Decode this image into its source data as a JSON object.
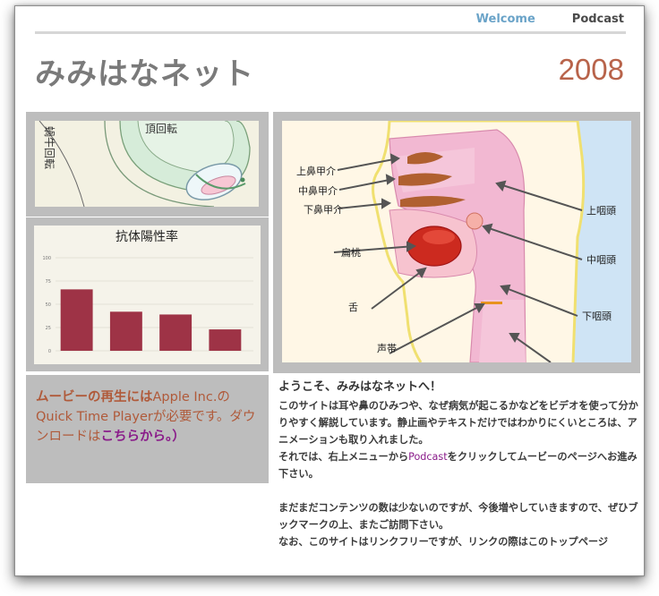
{
  "nav": {
    "welcome": "Welcome",
    "podcast": "Podcast"
  },
  "header": {
    "title": "みみはなネット",
    "year": "2008"
  },
  "cochlea": {
    "label1": "頂回転",
    "label2": "蝸牛回転"
  },
  "bar_chart": {
    "title": "抗体陽性率",
    "ticks": [
      "100",
      "75",
      "50",
      "25",
      "0"
    ],
    "chart_data": {
      "type": "bar",
      "title": "抗体陽性率",
      "categories": [
        "",
        "",
        "",
        ""
      ],
      "values": [
        66,
        42,
        39,
        23
      ],
      "ylim": [
        0,
        100
      ],
      "yticks": [
        0,
        25,
        50,
        75,
        100
      ],
      "color": "#9e3346"
    }
  },
  "promo": {
    "part1": "ムービーの再生には",
    "part2": "Apple Inc.の Quick Time Player",
    "part3": "が必要です。ダウンロードは",
    "link": "こちらから。）"
  },
  "anatomy": {
    "labels_left": [
      "上鼻甲介",
      "中鼻甲介",
      "下鼻甲介",
      "扁桃",
      "舌",
      "声帯"
    ],
    "labels_right": [
      "上咽頭",
      "中咽頭",
      "下咽頭"
    ]
  },
  "content": {
    "welcome": "ようこそ、みみはなネットへ！",
    "para1": "このサイトは耳や鼻のひみつや、なぜ病気が起こるかなどをビデオを使って分かりやすく解説しています。静止画やテキストだけではわかりにくいところは、アニメーションも取り入れました。",
    "para2_pre": "それでは、右上メニューから",
    "para2_link": "Podcast",
    "para2_post": "をクリックしてムービーのページへお進み下さい。",
    "para3": "まだまだコンテンツの数は少ないのですが、今後増やしていきますので、ぜひブックマークの上、またご訪問下さい。",
    "para4": "なお、このサイトはリンクフリーですが、リンクの際はこのトップページ"
  },
  "colors": {
    "accent": "#b8634a",
    "link": "#8a1c8a",
    "nav_active": "#6aa3c8"
  }
}
